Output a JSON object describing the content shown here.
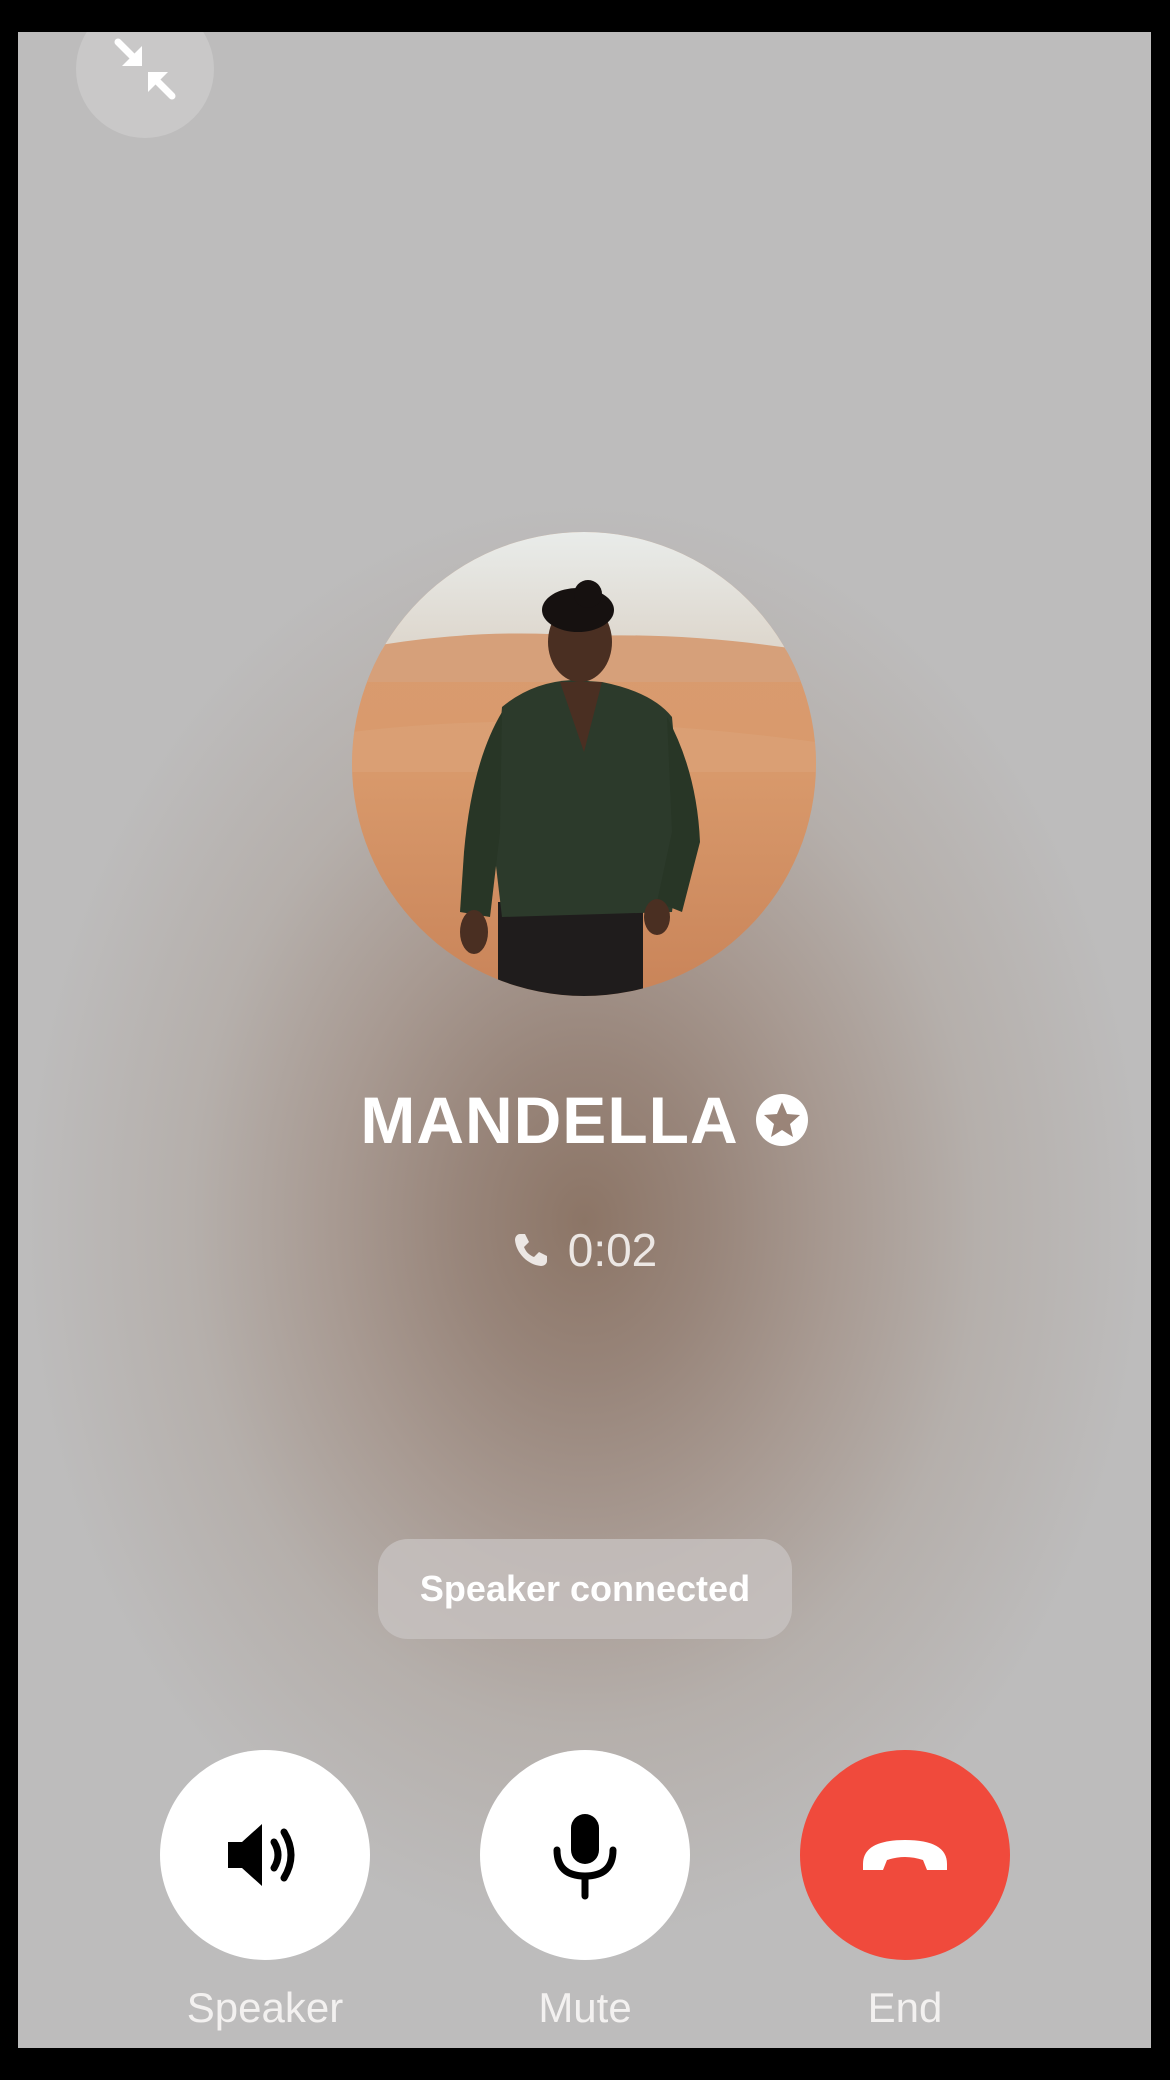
{
  "call": {
    "caller_name": "MANDELLA",
    "verified_icon": "star-badge-icon",
    "call_icon": "phone-icon",
    "duration": "0:02"
  },
  "toast": {
    "message": "Speaker connected"
  },
  "controls": {
    "speaker_label": "Speaker",
    "mute_label": "Mute",
    "end_label": "End",
    "speaker_icon": "speaker-icon",
    "mute_icon": "microphone-icon",
    "end_icon": "hang-up-icon",
    "minimize_icon": "minimize-arrows-icon"
  },
  "colors": {
    "end_button": "#f04a3c",
    "button_background": "#ffffff"
  }
}
